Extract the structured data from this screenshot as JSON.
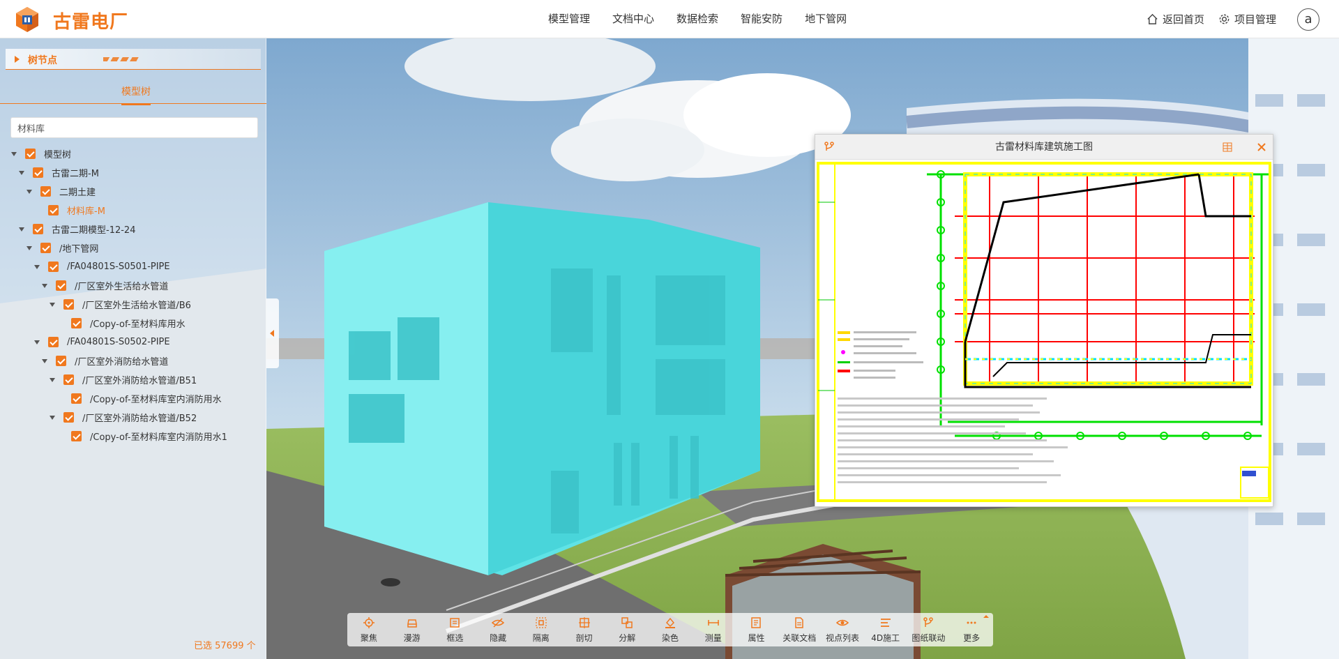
{
  "header": {
    "app_title": "古雷电厂",
    "nav": [
      "模型管理",
      "文档中心",
      "数据检索",
      "智能安防",
      "地下管网"
    ],
    "home_link": "返回首页",
    "project_link": "项目管理",
    "avatar_letter": "a"
  },
  "left_panel": {
    "section_title": "树节点",
    "tab_label": "模型树",
    "search_value": "材料库",
    "tree": [
      {
        "label": "模型树",
        "expanded": true,
        "checked": true
      },
      {
        "label": "古雷二期-M",
        "expanded": true,
        "checked": true
      },
      {
        "label": "二期土建",
        "expanded": true,
        "checked": true
      },
      {
        "label": "材料库-M",
        "expanded": false,
        "checked": true,
        "selected": true
      },
      {
        "label": "古雷二期模型-12-24",
        "expanded": true,
        "checked": true
      },
      {
        "label": "/地下管网",
        "expanded": true,
        "checked": true
      },
      {
        "label": "/FA04801S-S0501-PIPE",
        "expanded": true,
        "checked": true
      },
      {
        "label": "/厂区室外生活给水管道",
        "expanded": true,
        "checked": true
      },
      {
        "label": "/厂区室外生活给水管道/B6",
        "expanded": true,
        "checked": true
      },
      {
        "label": "/Copy-of-至材料库用水",
        "expanded": false,
        "checked": true
      },
      {
        "label": "/FA04801S-S0502-PIPE",
        "expanded": true,
        "checked": true
      },
      {
        "label": "/厂区室外消防给水管道",
        "expanded": true,
        "checked": true
      },
      {
        "label": "/厂区室外消防给水管道/B51",
        "expanded": true,
        "checked": true
      },
      {
        "label": "/Copy-of-至材料库室内消防用水",
        "expanded": false,
        "checked": true
      },
      {
        "label": "/厂区室外消防给水管道/B52",
        "expanded": true,
        "checked": true
      },
      {
        "label": "/Copy-of-至材料库室内消防用水1",
        "expanded": false,
        "checked": true
      }
    ],
    "selected_count": "已选 57699 个"
  },
  "doc_window": {
    "title": "古雷材料库建筑施工图"
  },
  "toolbar": {
    "tools": [
      {
        "label": "聚焦",
        "icon": "focus-icon"
      },
      {
        "label": "漫游",
        "icon": "car-icon"
      },
      {
        "label": "框选",
        "icon": "box-select-icon"
      },
      {
        "label": "隐藏",
        "icon": "eye-off-icon"
      },
      {
        "label": "隔离",
        "icon": "isolate-icon"
      },
      {
        "label": "剖切",
        "icon": "section-icon"
      },
      {
        "label": "分解",
        "icon": "explode-icon"
      },
      {
        "label": "染色",
        "icon": "paint-bucket-icon"
      },
      {
        "label": "测量",
        "icon": "ruler-icon"
      },
      {
        "label": "属性",
        "icon": "properties-icon"
      },
      {
        "label": "关联文档",
        "icon": "document-icon"
      },
      {
        "label": "视点列表",
        "icon": "viewpoint-icon"
      },
      {
        "label": "4D施工",
        "icon": "timeline-icon"
      },
      {
        "label": "图纸联动",
        "icon": "link-icon"
      },
      {
        "label": "更多",
        "icon": "more-icon"
      }
    ]
  },
  "colors": {
    "accent": "#f0781e",
    "building": "#7ff0f0"
  }
}
